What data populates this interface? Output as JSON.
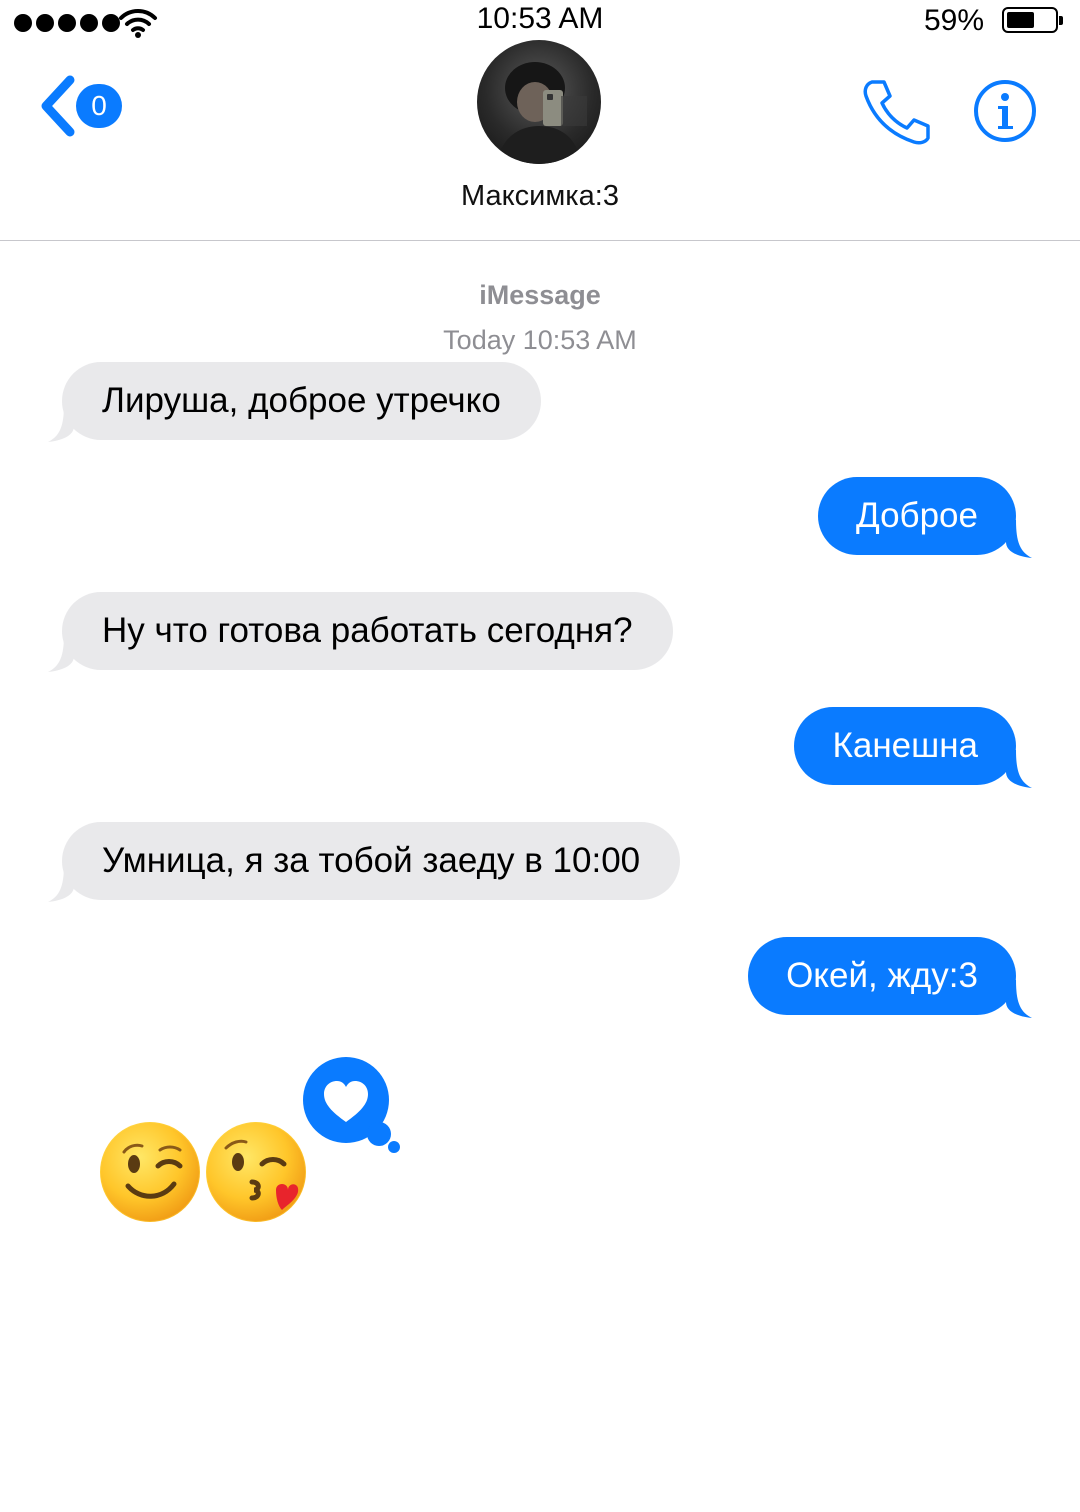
{
  "status_bar": {
    "time": "10:53 AM",
    "battery_percent": "59%",
    "battery_level": 0.59
  },
  "header": {
    "back_badge": "0",
    "contact_name": "Максимка:3"
  },
  "conversation": {
    "service": "iMessage",
    "timestamp": "Today 10:53 AM"
  },
  "messages": [
    {
      "direction": "incoming",
      "text": "Лируша, доброе утречко"
    },
    {
      "direction": "outgoing",
      "text": "Доброе"
    },
    {
      "direction": "incoming",
      "text": "Ну что готова работать сегодня?"
    },
    {
      "direction": "outgoing",
      "text": "Канешна"
    },
    {
      "direction": "incoming",
      "text": "Умница, я за тобой заеду в 10:00"
    },
    {
      "direction": "outgoing",
      "text": "Окей, жду:3"
    }
  ],
  "reactions": {
    "emojis": [
      "winking-face",
      "face-blowing-kiss"
    ],
    "tapback": "heart"
  },
  "colors": {
    "accent": "#0a7bff",
    "incoming_bubble": "#e9e9eb",
    "meta_text": "#8e8e93"
  }
}
